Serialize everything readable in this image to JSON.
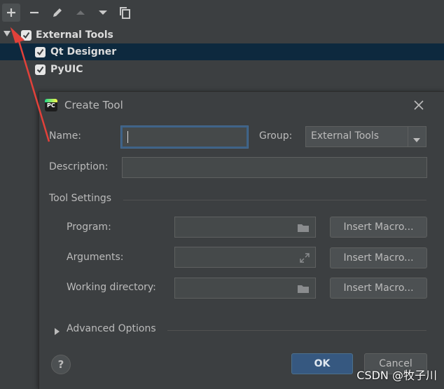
{
  "toolbar": {
    "icons": [
      "plus-icon",
      "minus-icon",
      "edit-icon",
      "move-up-icon",
      "move-down-icon",
      "copy-icon"
    ]
  },
  "tree": {
    "group_label": "External Tools",
    "items": [
      {
        "label": "Qt Designer",
        "checked": true
      },
      {
        "label": "PyUIC",
        "checked": true
      }
    ]
  },
  "dialog": {
    "title": "Create Tool",
    "name_label": "Name:",
    "name_value": "",
    "group_label": "Group:",
    "group_value": "External Tools",
    "description_label": "Description:",
    "description_value": "",
    "tool_settings_label": "Tool Settings",
    "program_label": "Program:",
    "arguments_label": "Arguments:",
    "working_dir_label": "Working directory:",
    "insert_macro_label": "Insert Macro...",
    "advanced_label": "Advanced Options",
    "ok_label": "OK",
    "cancel_label": "Cancel",
    "help_label": "?"
  },
  "watermark": "CSDN @牧子川",
  "colors": {
    "background": "#3c3f41",
    "selection": "#0d293e",
    "primary_button": "#365880",
    "arrow": "#e2413a"
  }
}
